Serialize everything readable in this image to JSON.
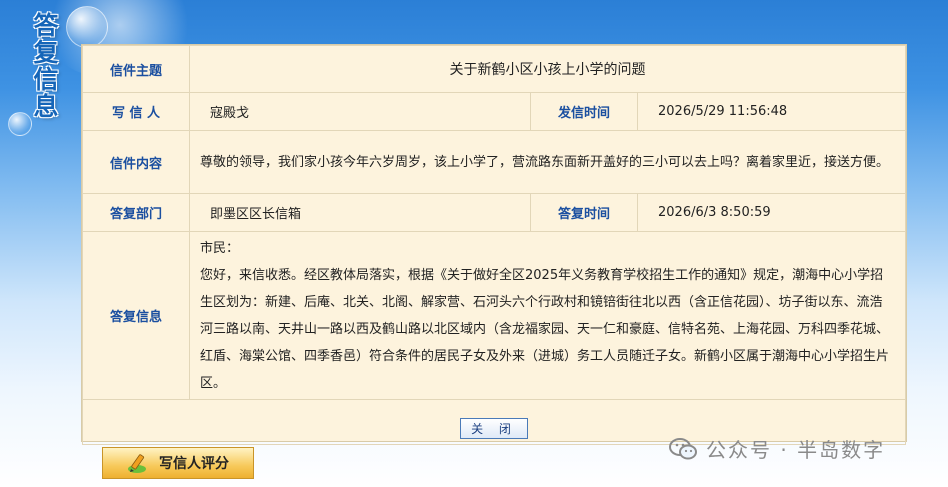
{
  "side_title": "答复信息",
  "rows": {
    "subject": {
      "label": "信件主题",
      "value": "关于新鹤小区小孩上小学的问题"
    },
    "writer": {
      "label": "写 信 人",
      "value": "寇殿戈"
    },
    "send_time": {
      "label": "发信时间",
      "value": "2026/5/29 11:56:48"
    },
    "content": {
      "label": "信件内容",
      "value": "尊敬的领导，我们家小孩今年六岁周岁，该上小学了，营流路东面新开盖好的三小可以去上吗？离着家里近，接送方便。"
    },
    "dept": {
      "label": "答复部门",
      "value": "即墨区区长信箱"
    },
    "reply_time": {
      "label": "答复时间",
      "value": "2026/6/3 8:50:59"
    },
    "reply": {
      "label": "答复信息",
      "lines": [
        "市民：",
        "您好，来信收悉。经区教体局落实，根据《关于做好全区2025年义务教育学校招生工作的通知》规定，潮海中心小学招生区划为：新建、后庵、北关、北阁、解家营、石河头六个行政村和镜锫街往北以西（含正信花园）、坊子街以东、流浩河三路以南、天井山一路以西及鹤山路以北区域内（含龙福家园、天一仁和豪庭、信特名苑、上海花园、万科四季花城、红盾、海棠公馆、四季香邑）符合条件的居民子女及外来（进城）务工人员随迁子女。新鹤小区属于潮海中心小学招生片区。"
      ]
    }
  },
  "close_label": "关 闭",
  "rate_label": "写信人评分",
  "watermark": {
    "text": "公众号 · 半岛数字",
    "icon": "wechat-icon"
  },
  "colors": {
    "label_blue": "#1b4fa0",
    "panel_bg": "#fdf3dd"
  }
}
